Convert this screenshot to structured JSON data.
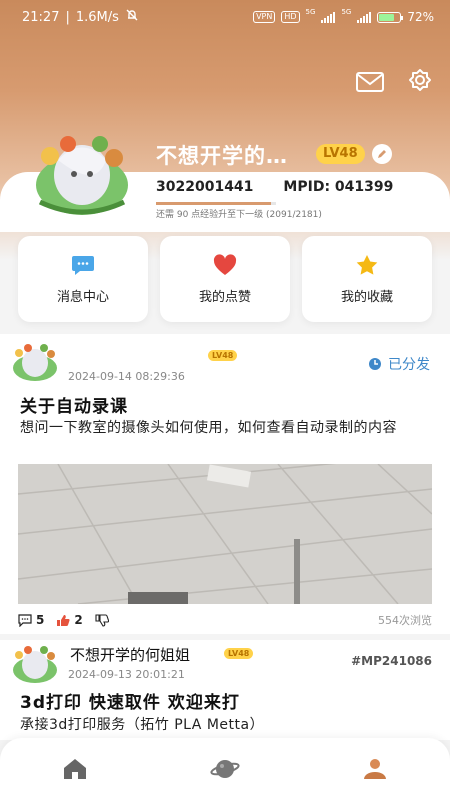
{
  "status_bar": {
    "time": "21:27",
    "speed": "1.6M/s",
    "vpn": "VPN",
    "hd": "HD",
    "net1": "5G",
    "net2": "5G",
    "battery": "72%",
    "battery_level": 0.72
  },
  "profile": {
    "username": "不想开学的…",
    "level": "LV48",
    "uid": "3022001441",
    "mpid": "MPID: 041399",
    "xp_text": "还需 90 点经验升至下一级 (2091/2181)",
    "xp_progress": 0.959
  },
  "quick_actions": [
    {
      "label": "消息中心",
      "icon": "chat-bubble-icon"
    },
    {
      "label": "我的点赞",
      "icon": "heart-icon"
    },
    {
      "label": "我的收藏",
      "icon": "star-icon"
    }
  ],
  "posts": [
    {
      "author": "",
      "level": "LV48",
      "time": "2024-09-14 08:29:36",
      "status": "已分发",
      "title": "关于自动录课",
      "body": "想问一下教室的摄像头如何使用，如何查看自动录制的内容",
      "comments": "5",
      "likes": "2",
      "views": "554次浏览"
    },
    {
      "author": "不想开学的何姐姐",
      "level": "LV48",
      "time": "2024-09-13 20:01:21",
      "tag": "#MP241086",
      "title": "3d打印 快速取件 欢迎来打",
      "body": "承接3d打印服务（拓竹 PLA Metta）"
    }
  ],
  "colors": {
    "header": "#d79b70",
    "accent_blue": "#3f88c9",
    "level_badge": "#ffd24a",
    "like_red": "#e5533d"
  },
  "nav": [
    "home-icon",
    "planet-icon",
    "profile-icon"
  ]
}
